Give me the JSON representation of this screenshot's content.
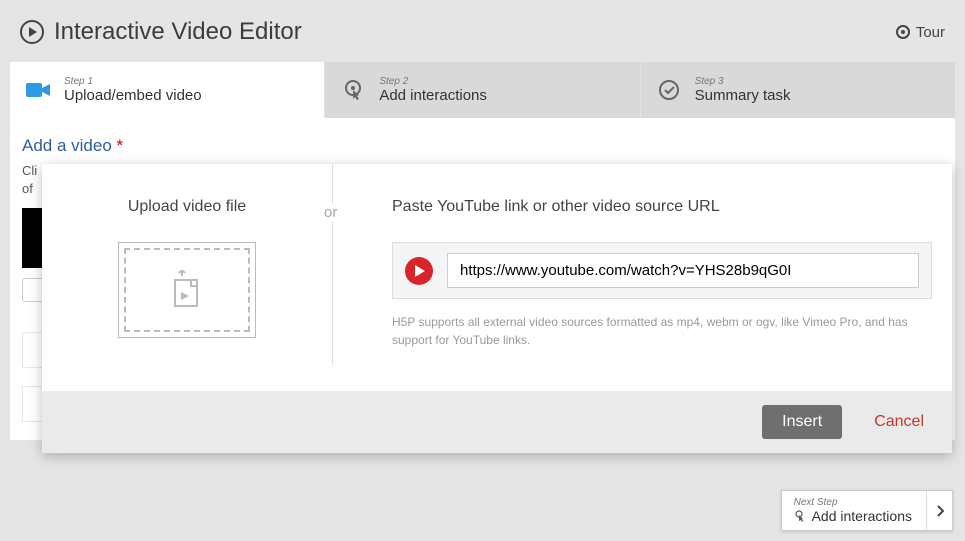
{
  "header": {
    "title": "Interactive Video Editor",
    "tour_label": "Tour"
  },
  "tabs": [
    {
      "step": "Step 1",
      "label": "Upload/embed video"
    },
    {
      "step": "Step 2",
      "label": "Add interactions"
    },
    {
      "step": "Step 3",
      "label": "Summary task"
    }
  ],
  "panel": {
    "section_title": "Add a video",
    "required_mark": "*",
    "help_line1": "Cli",
    "help_line2": "of"
  },
  "dialog": {
    "upload_heading": "Upload video file",
    "or_label": "or",
    "paste_heading": "Paste YouTube link or other video source URL",
    "url_value": "https://www.youtube.com/watch?v=YHS28b9qG0I",
    "url_help": "H5P supports all external video sources formatted as mp4, webm or ogv, like Vimeo Pro, and has support for YouTube links.",
    "insert_label": "Insert",
    "cancel_label": "Cancel"
  },
  "next_step": {
    "label": "Next Step",
    "action": "Add interactions"
  }
}
